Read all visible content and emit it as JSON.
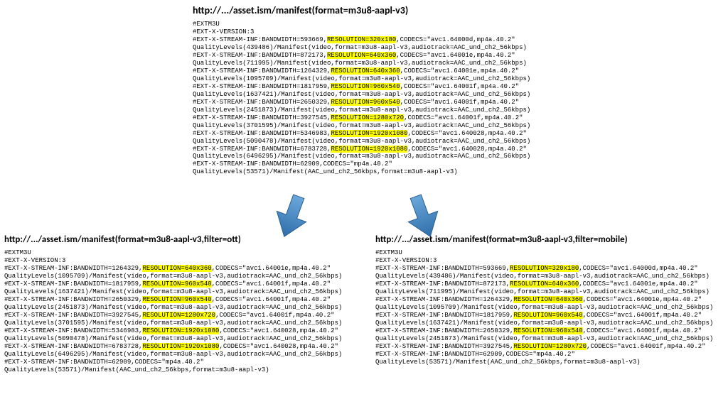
{
  "top": {
    "url": "http://.../asset.ism/manifest(format=m3u8-aapl-v3)",
    "lines": [
      {
        "segs": [
          {
            "t": "#EXTM3U"
          }
        ]
      },
      {
        "segs": [
          {
            "t": "#EXT-X-VERSION:3"
          }
        ]
      },
      {
        "segs": [
          {
            "t": "#EXT-X-STREAM-INF:BANDWIDTH=593669,"
          },
          {
            "t": "RESOLUTION=320x180",
            "hl": true
          },
          {
            "t": ",CODECS=\"avc1.64000d,mp4a.40.2\""
          }
        ]
      },
      {
        "segs": [
          {
            "t": "QualityLevels(439486)/Manifest(video,format=m3u8-aapl-v3,audiotrack=AAC_und_ch2_56kbps)"
          }
        ]
      },
      {
        "segs": [
          {
            "t": "#EXT-X-STREAM-INF:BANDWIDTH=872173,"
          },
          {
            "t": "RESOLUTION=640x360",
            "hl": true
          },
          {
            "t": ",CODECS=\"avc1.64001e,mp4a.40.2\""
          }
        ]
      },
      {
        "segs": [
          {
            "t": "QualityLevels(711995)/Manifest(video,format=m3u8-aapl-v3,audiotrack=AAC_und_ch2_56kbps)"
          }
        ]
      },
      {
        "segs": [
          {
            "t": "#EXT-X-STREAM-INF:BANDWIDTH=1264329,"
          },
          {
            "t": "RESOLUTION=640x360",
            "hl": true
          },
          {
            "t": ",CODECS=\"avc1.64001e,mp4a.40.2\""
          }
        ]
      },
      {
        "segs": [
          {
            "t": "QualityLevels(1095709)/Manifest(video,format=m3u8-aapl-v3,audiotrack=AAC_und_ch2_56kbps)"
          }
        ]
      },
      {
        "segs": [
          {
            "t": "#EXT-X-STREAM-INF:BANDWIDTH=1817959,"
          },
          {
            "t": "RESOLUTION=960x540",
            "hl": true
          },
          {
            "t": ",CODECS=\"avc1.64001f,mp4a.40.2\""
          }
        ]
      },
      {
        "segs": [
          {
            "t": "QualityLevels(1637421)/Manifest(video,format=m3u8-aapl-v3,audiotrack=AAC_und_ch2_56kbps)"
          }
        ]
      },
      {
        "segs": [
          {
            "t": "#EXT-X-STREAM-INF:BANDWIDTH=2650329,"
          },
          {
            "t": "RESOLUTION=960x540",
            "hl": true
          },
          {
            "t": ",CODECS=\"avc1.64001f,mp4a.40.2\""
          }
        ]
      },
      {
        "segs": [
          {
            "t": "QualityLevels(2451873)/Manifest(video,format=m3u8-aapl-v3,audiotrack=AAC_und_ch2_56kbps)"
          }
        ]
      },
      {
        "segs": [
          {
            "t": "#EXT-X-STREAM-INF:BANDWIDTH=3927545,"
          },
          {
            "t": "RESOLUTION=1280x720",
            "hl": true
          },
          {
            "t": ",CODECS=\"avc1.64001f,mp4a.40.2\""
          }
        ]
      },
      {
        "segs": [
          {
            "t": "QualityLevels(3701595)/Manifest(video,format=m3u8-aapl-v3,audiotrack=AAC_und_ch2_56kbps)"
          }
        ]
      },
      {
        "segs": [
          {
            "t": "#EXT-X-STREAM-INF:BANDWIDTH=5346983,"
          },
          {
            "t": "RESOLUTION=1920x1080",
            "hl": true
          },
          {
            "t": ",CODECS=\"avc1.640028,mp4a.40.2\""
          }
        ]
      },
      {
        "segs": [
          {
            "t": "QualityLevels(5090478)/Manifest(video,format=m3u8-aapl-v3,audiotrack=AAC_und_ch2_56kbps)"
          }
        ]
      },
      {
        "segs": [
          {
            "t": "#EXT-X-STREAM-INF:BANDWIDTH=6783728,"
          },
          {
            "t": "RESOLUTION=1920x1080",
            "hl": true
          },
          {
            "t": ",CODECS=\"avc1.640028,mp4a.40.2\""
          }
        ]
      },
      {
        "segs": [
          {
            "t": "QualityLevels(6496295)/Manifest(video,format=m3u8-aapl-v3,audiotrack=AAC_und_ch2_56kbps)"
          }
        ]
      },
      {
        "segs": [
          {
            "t": "#EXT-X-STREAM-INF:BANDWIDTH=62909,CODECS=\"mp4a.40.2\""
          }
        ]
      },
      {
        "segs": [
          {
            "t": "QualityLevels(53571)/Manifest(AAC_und_ch2_56kbps,format=m3u8-aapl-v3)"
          }
        ]
      }
    ]
  },
  "left": {
    "url": "http://.../asset.ism/manifest(format=m3u8-aapl-v3,filter=ott)",
    "lines": [
      {
        "segs": [
          {
            "t": "#EXTM3U"
          }
        ]
      },
      {
        "segs": [
          {
            "t": "#EXT-X-VERSION:3"
          }
        ]
      },
      {
        "segs": [
          {
            "t": "#EXT-X-STREAM-INF:BANDWIDTH=1264329,"
          },
          {
            "t": "RESOLUTION=640x360",
            "hl": true
          },
          {
            "t": ",CODECS=\"avc1.64001e,mp4a.40.2\""
          }
        ]
      },
      {
        "segs": [
          {
            "t": "QualityLevels(1095709)/Manifest(video,format=m3u8-aapl-v3,audiotrack=AAC_und_ch2_56kbps)"
          }
        ]
      },
      {
        "segs": [
          {
            "t": "#EXT-X-STREAM-INF:BANDWIDTH=1817959,"
          },
          {
            "t": "RESOLUTION=960x540",
            "hl": true
          },
          {
            "t": ",CODECS=\"avc1.64001f,mp4a.40.2\""
          }
        ]
      },
      {
        "segs": [
          {
            "t": "QualityLevels(1637421)/Manifest(video,format=m3u8-aapl-v3,audiotrack=AAC_und_ch2_56kbps)"
          }
        ]
      },
      {
        "segs": [
          {
            "t": "#EXT-X-STREAM-INF:BANDWIDTH=2650329,"
          },
          {
            "t": "RESOLUTION=960x540",
            "hl": true
          },
          {
            "t": ",CODECS=\"avc1.64001f,mp4a.40.2\""
          }
        ]
      },
      {
        "segs": [
          {
            "t": "QualityLevels(2451873)/Manifest(video,format=m3u8-aapl-v3,audiotrack=AAC_und_ch2_56kbps)"
          }
        ]
      },
      {
        "segs": [
          {
            "t": "#EXT-X-STREAM-INF:BANDWIDTH=3927545,"
          },
          {
            "t": "RESOLUTION=1280x720",
            "hl": true
          },
          {
            "t": ",CODECS=\"avc1.64001f,mp4a.40.2\""
          }
        ]
      },
      {
        "segs": [
          {
            "t": "QualityLevels(3701595)/Manifest(video,format=m3u8-aapl-v3,audiotrack=AAC_und_ch2_56kbps)"
          }
        ]
      },
      {
        "segs": [
          {
            "t": "#EXT-X-STREAM-INF:BANDWIDTH=5346983,"
          },
          {
            "t": "RESOLUTION=1920x1080",
            "hl": true
          },
          {
            "t": ",CODECS=\"avc1.640028,mp4a.40.2\""
          }
        ]
      },
      {
        "segs": [
          {
            "t": "QualityLevels(5090478)/Manifest(video,format=m3u8-aapl-v3,audiotrack=AAC_und_ch2_56kbps)"
          }
        ]
      },
      {
        "segs": [
          {
            "t": "#EXT-X-STREAM-INF:BANDWIDTH=6783728,"
          },
          {
            "t": "RESOLUTION=1920x1080",
            "hl": true
          },
          {
            "t": ",CODECS=\"avc1.640028,mp4a.40.2\""
          }
        ]
      },
      {
        "segs": [
          {
            "t": "QualityLevels(6496295)/Manifest(video,format=m3u8-aapl-v3,audiotrack=AAC_und_ch2_56kbps)"
          }
        ]
      },
      {
        "segs": [
          {
            "t": "#EXT-X-STREAM-INF:BANDWIDTH=62909,CODECS=\"mp4a.40.2\""
          }
        ]
      },
      {
        "segs": [
          {
            "t": "QualityLevels(53571)/Manifest(AAC_und_ch2_56kbps,format=m3u8-aapl-v3)"
          }
        ]
      }
    ]
  },
  "right": {
    "url": "http://.../asset.ism/manifest(format=m3u8-aapl-v3,filter=mobile)",
    "lines": [
      {
        "segs": [
          {
            "t": "#EXTM3U"
          }
        ]
      },
      {
        "segs": [
          {
            "t": "#EXT-X-VERSION:3"
          }
        ]
      },
      {
        "segs": [
          {
            "t": "#EXT-X-STREAM-INF:BANDWIDTH=593669,"
          },
          {
            "t": "RESOLUTION=320x180",
            "hl": true
          },
          {
            "t": ",CODECS=\"avc1.64000d,mp4a.40.2\""
          }
        ]
      },
      {
        "segs": [
          {
            "t": "QualityLevels(439486)/Manifest(video,format=m3u8-aapl-v3,audiotrack=AAC_und_ch2_56kbps)"
          }
        ]
      },
      {
        "segs": [
          {
            "t": "#EXT-X-STREAM-INF:BANDWIDTH=872173,"
          },
          {
            "t": "RESOLUTION=640x360",
            "hl": true
          },
          {
            "t": ",CODECS=\"avc1.64001e,mp4a.40.2\""
          }
        ]
      },
      {
        "segs": [
          {
            "t": "QualityLevels(711995)/Manifest(video,format=m3u8-aapl-v3,audiotrack=AAC_und_ch2_56kbps)"
          }
        ]
      },
      {
        "segs": [
          {
            "t": "#EXT-X-STREAM-INF:BANDWIDTH=1264329,"
          },
          {
            "t": "RESOLUTION=640x360",
            "hl": true
          },
          {
            "t": ",CODECS=\"avc1.64001e,mp4a.40.2\""
          }
        ]
      },
      {
        "segs": [
          {
            "t": "QualityLevels(1095709)/Manifest(video,format=m3u8-aapl-v3,audiotrack=AAC_und_ch2_56kbps)"
          }
        ]
      },
      {
        "segs": [
          {
            "t": "#EXT-X-STREAM-INF:BANDWIDTH=1817959,"
          },
          {
            "t": "RESOLUTION=960x540",
            "hl": true
          },
          {
            "t": ",CODECS=\"avc1.64001f,mp4a.40.2\""
          }
        ]
      },
      {
        "segs": [
          {
            "t": "QualityLevels(1637421)/Manifest(video,format=m3u8-aapl-v3,audiotrack=AAC_und_ch2_56kbps)"
          }
        ]
      },
      {
        "segs": [
          {
            "t": "#EXT-X-STREAM-INF:BANDWIDTH=2650329,"
          },
          {
            "t": "RESOLUTION=960x540",
            "hl": true
          },
          {
            "t": ",CODECS=\"avc1.64001f,mp4a.40.2\""
          }
        ]
      },
      {
        "segs": [
          {
            "t": "QualityLevels(2451873)/Manifest(video,format=m3u8-aapl-v3,audiotrack=AAC_und_ch2_56kbps)"
          }
        ]
      },
      {
        "segs": [
          {
            "t": "#EXT-X-STREAM-INF:BANDWIDTH=3927545,"
          },
          {
            "t": "RESOLUTION=1280x720",
            "hl": true
          },
          {
            "t": ",CODECS=\"avc1.64001f,mp4a.40.2\""
          }
        ]
      },
      {
        "segs": [
          {
            "t": "#EXT-X-STREAM-INF:BANDWIDTH=62909,CODECS=\"mp4a.40.2\""
          }
        ]
      },
      {
        "segs": [
          {
            "t": "QualityLevels(53571)/Manifest(AAC_und_ch2_56kbps,format=m3u8-aapl-v3)"
          }
        ]
      }
    ]
  },
  "arrowColor": "#3b82c4"
}
